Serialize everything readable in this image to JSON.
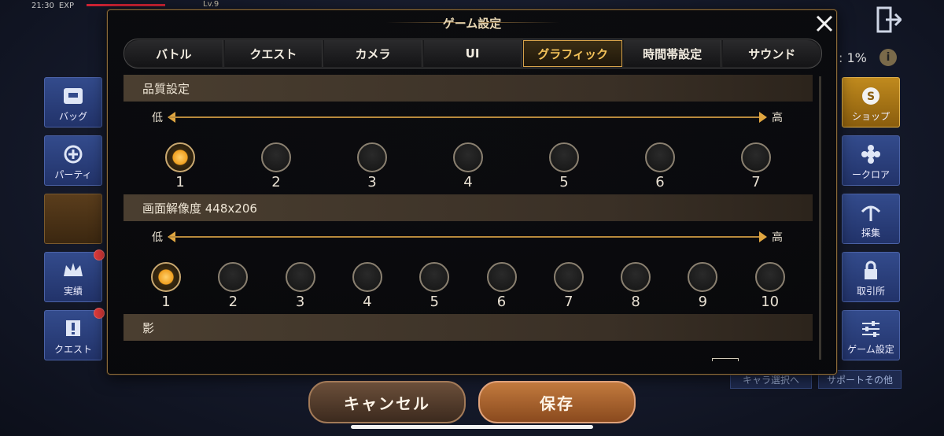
{
  "status_bar": {
    "time": "21:30",
    "exp_label": "EXP",
    "level": "Lv.9"
  },
  "hud": {
    "percent_text": ": 1%",
    "left_buttons": [
      {
        "label": "バッグ"
      },
      {
        "label": "パーティ"
      },
      {
        "label": ""
      },
      {
        "label": "実績"
      },
      {
        "label": "クエスト"
      }
    ],
    "right_buttons": [
      {
        "label": "ショップ"
      },
      {
        "label": "ークロア"
      },
      {
        "label": "採集"
      },
      {
        "label": "取引所"
      },
      {
        "label": "ゲーム設定"
      }
    ],
    "links": [
      "キャラ選択へ",
      "サポートその他"
    ]
  },
  "dialog": {
    "title": "ゲーム設定",
    "tabs": [
      "バトル",
      "クエスト",
      "カメラ",
      "UI",
      "グラフィック",
      "時間帯設定",
      "サウンド"
    ],
    "active_tab": "グラフィック",
    "sections": {
      "quality": {
        "header": "品質設定",
        "low_label": "低",
        "high_label": "高",
        "options": [
          "1",
          "2",
          "3",
          "4",
          "5",
          "6",
          "7"
        ],
        "selected": "1"
      },
      "resolution": {
        "header": "画面解像度  448x206",
        "low_label": "低",
        "high_label": "高",
        "options": [
          "1",
          "2",
          "3",
          "4",
          "5",
          "6",
          "7",
          "8",
          "9",
          "10"
        ],
        "selected": "1"
      },
      "shadow": {
        "header": "影"
      }
    }
  },
  "buttons": {
    "cancel": "キャンセル",
    "save": "保存"
  },
  "colors": {
    "accent": "#f3c25a",
    "selected_knob": "#f0a020",
    "save_button": "#c27a3e"
  }
}
